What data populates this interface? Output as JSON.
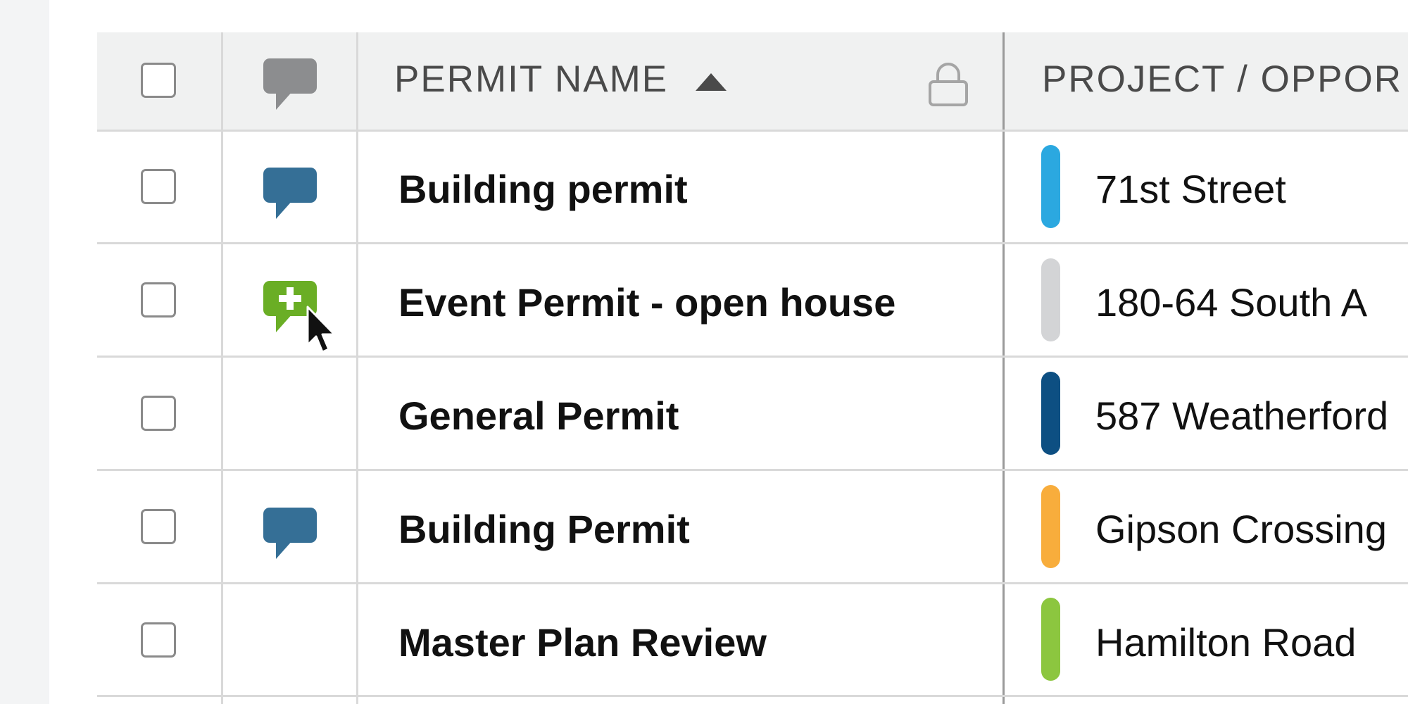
{
  "header": {
    "permit_name_label": "PERMIT NAME",
    "project_label": "PROJECT / OPPOR"
  },
  "rows": [
    {
      "permit_name": "Building permit",
      "project": "71st Street",
      "project_color": "#2ba8e0",
      "comment_icon": "comment-icon"
    },
    {
      "permit_name": "Event Permit - open house",
      "project": "180-64 South A",
      "project_color": "#d3d4d6",
      "comment_icon": "add-comment-icon"
    },
    {
      "permit_name": "General Permit",
      "project": "587 Weatherford",
      "project_color": "#0d4f82",
      "comment_icon": ""
    },
    {
      "permit_name": "Building Permit",
      "project": "Gipson Crossing",
      "project_color": "#f8ad3c",
      "comment_icon": "comment-icon"
    },
    {
      "permit_name": "Master Plan Review",
      "project": "Hamilton Road",
      "project_color": "#8cc63f",
      "comment_icon": ""
    }
  ],
  "colors": {
    "comment_existing": "#356f96",
    "comment_add": "#6aae25",
    "comment_header": "#8c8d8f"
  }
}
